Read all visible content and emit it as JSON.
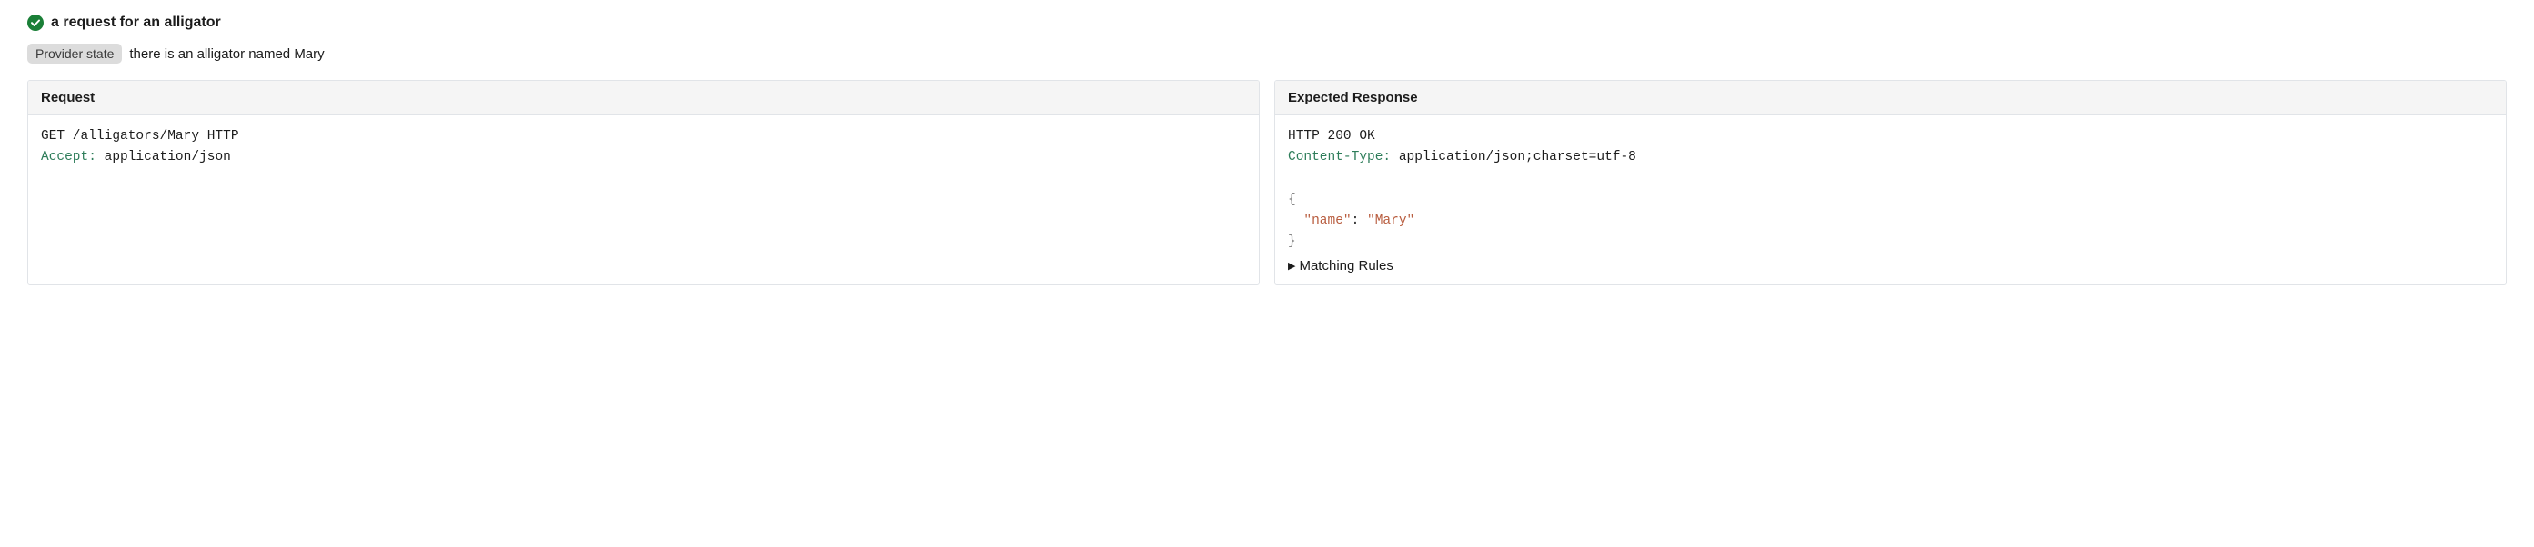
{
  "header": {
    "title": "a request for an alligator"
  },
  "provider_state": {
    "badge": "Provider state",
    "text": "there is an alligator named Mary"
  },
  "request_panel": {
    "title": "Request",
    "request_line": "GET /alligators/Mary HTTP",
    "header_name": "Accept:",
    "header_value": " application/json"
  },
  "response_panel": {
    "title": "Expected Response",
    "status_line": "HTTP 200 OK",
    "header_name": "Content-Type:",
    "header_value": " application/json;charset=utf-8",
    "body": {
      "open": "{",
      "indent": "  ",
      "key": "\"name\"",
      "colon": ": ",
      "value": "\"Mary\"",
      "close": "}"
    },
    "matching_rules_label": "Matching Rules"
  }
}
